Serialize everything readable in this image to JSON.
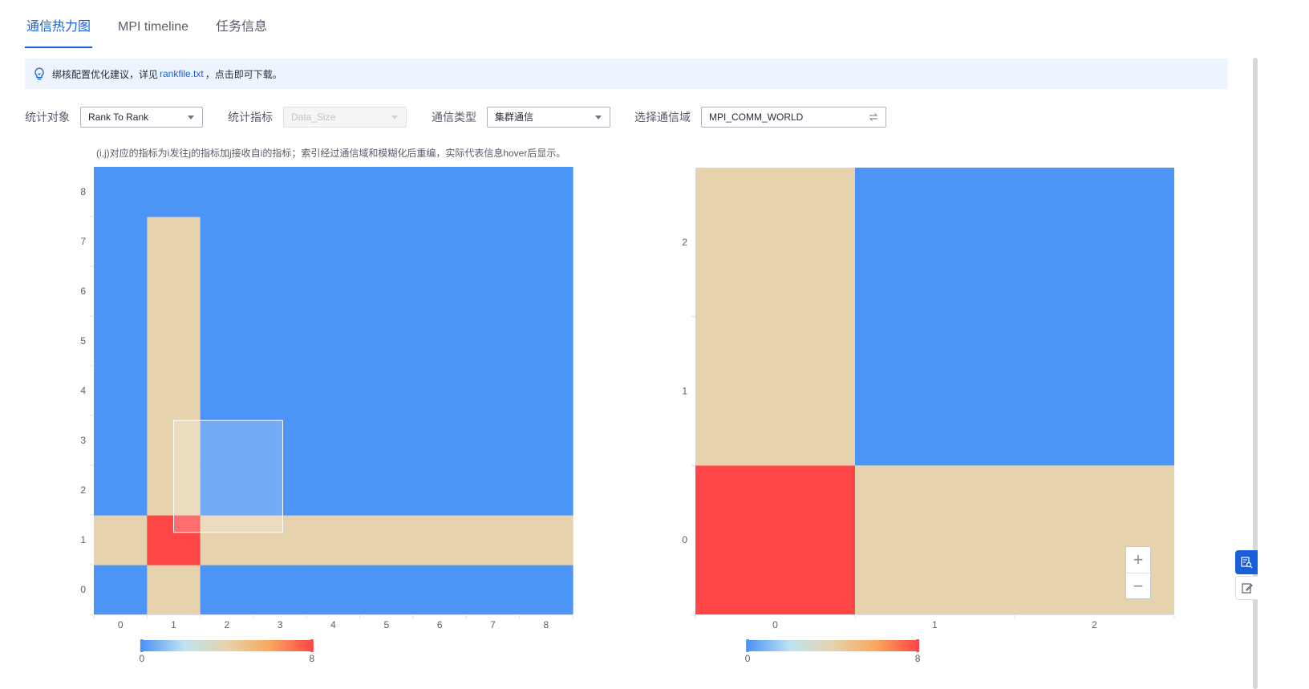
{
  "tabs": [
    {
      "label": "通信热力图",
      "active": true
    },
    {
      "label": "MPI timeline",
      "active": false
    },
    {
      "label": "任务信息",
      "active": false
    }
  ],
  "tip": {
    "prefix": "绑核配置优化建议，详见",
    "link": "rankfile.txt",
    "suffix": "，点击即可下载。",
    "icon": "lightbulb-icon"
  },
  "filters": {
    "object_label": "统计对象",
    "object_value": "Rank To Rank",
    "metric_label": "统计指标",
    "metric_value": "Data_Size",
    "comm_type_label": "通信类型",
    "comm_type_value": "集群通信",
    "domain_label": "选择通信域",
    "domain_value": "MPI_COMM_WORLD"
  },
  "note": "(i,j)对应的指标为i发往j的指标加j接收自i的指标；索引经过通信域和模糊化后重编，实际代表信息hover后显示。",
  "colors": {
    "low": "#4d94f7",
    "mid": "#e6d3ad",
    "high": "#ff4646",
    "accent": "#1a5fda"
  },
  "chart_data": [
    {
      "type": "heatmap",
      "x": [
        "0",
        "1",
        "2",
        "3",
        "4",
        "5",
        "6",
        "7",
        "8"
      ],
      "y": [
        "0",
        "1",
        "2",
        "3",
        "4",
        "5",
        "6",
        "7",
        "8"
      ],
      "mid_cells": [
        [
          0,
          1
        ],
        [
          2,
          1
        ],
        [
          3,
          1
        ],
        [
          4,
          1
        ],
        [
          5,
          1
        ],
        [
          6,
          1
        ],
        [
          7,
          1
        ],
        [
          8,
          1
        ],
        [
          1,
          0
        ],
        [
          1,
          2
        ],
        [
          1,
          3
        ],
        [
          1,
          4
        ],
        [
          1,
          5
        ],
        [
          1,
          6
        ],
        [
          1,
          7
        ]
      ],
      "high_cells": [
        [
          1,
          1
        ]
      ],
      "visual_map": {
        "min": 0,
        "max": 8,
        "colors": [
          "#4d94f7",
          "#bfe3f0",
          "#e6d3ad",
          "#f8a95d",
          "#ff4646"
        ],
        "min_label": "0",
        "max_label": "8"
      },
      "grid": false,
      "selection_box": true
    },
    {
      "type": "heatmap",
      "x": [
        "0",
        "1",
        "2"
      ],
      "y": [
        "0",
        "1",
        "2"
      ],
      "cells": [
        {
          "x": 0,
          "y": 0,
          "level": "high",
          "w": 1,
          "h": 1
        },
        {
          "x": 1,
          "y": 0,
          "level": "mid",
          "w": 2,
          "h": 1
        },
        {
          "x": 0,
          "y": 1,
          "level": "mid",
          "w": 1,
          "h": 2
        },
        {
          "x": 1,
          "y": 1,
          "level": "low",
          "w": 2,
          "h": 2
        }
      ],
      "visual_map": {
        "min": 0,
        "max": 8,
        "colors": [
          "#4d94f7",
          "#bfe3f0",
          "#e6d3ad",
          "#f8a95d",
          "#ff4646"
        ],
        "min_label": "0",
        "max_label": "8"
      },
      "grid": false
    }
  ],
  "zoom": {
    "in": "+",
    "out": "−"
  }
}
